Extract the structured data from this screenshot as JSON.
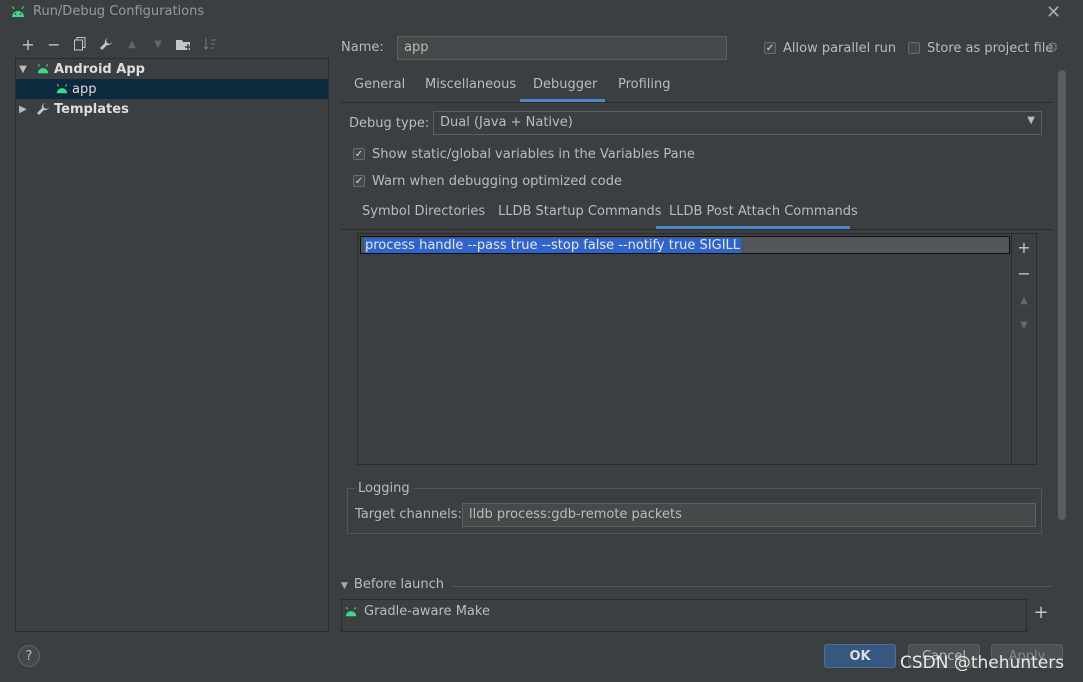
{
  "window": {
    "title": "Run/Debug Configurations"
  },
  "toolbar": {
    "icons": [
      "plus-icon",
      "minus-icon",
      "copy-icon",
      "wrench-icon",
      "arrow-up-icon",
      "arrow-down-icon",
      "folder-icon",
      "sort-icon"
    ]
  },
  "tree": {
    "items": [
      {
        "label": "Android App",
        "expanded": true
      },
      {
        "label": "app",
        "selected": true
      },
      {
        "label": "Templates",
        "expanded": false
      }
    ]
  },
  "form": {
    "name_label": "Name:",
    "name_value": "app",
    "allow_parallel_label": "Allow parallel run",
    "allow_parallel_checked": true,
    "store_project_label": "Store as project file",
    "store_project_checked": false
  },
  "tabs": [
    "General",
    "Miscellaneous",
    "Debugger",
    "Profiling"
  ],
  "active_tab": "Debugger",
  "debugger": {
    "debug_type_label": "Debug type:",
    "debug_type_value": "Dual (Java + Native)",
    "show_static_label": "Show static/global variables in the Variables Pane",
    "warn_optimized_label": "Warn when debugging optimized code",
    "subtabs": [
      "Symbol Directories",
      "LLDB Startup Commands",
      "LLDB Post Attach Commands"
    ],
    "active_subtab": "LLDB Post Attach Commands",
    "commands": [
      "process handle --pass true --stop false --notify true SIGILL"
    ]
  },
  "logging": {
    "title": "Logging",
    "target_label": "Target channels:",
    "target_value": "lldb process:gdb-remote packets"
  },
  "before_launch": {
    "title": "Before launch",
    "items": [
      "Gradle-aware Make"
    ]
  },
  "buttons": {
    "ok": "OK",
    "cancel": "Cancel",
    "apply": "Apply",
    "help": "?"
  },
  "watermark": "CSDN @thehunters",
  "colors": {
    "accent": "#4a88c7",
    "android_green": "#3ddc84",
    "selection": "#2f65ca"
  }
}
